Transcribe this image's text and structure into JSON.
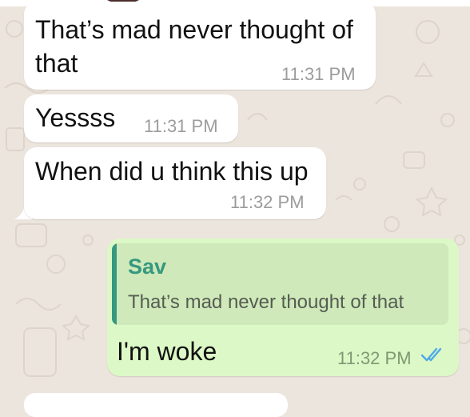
{
  "chat": {
    "messages": [
      {
        "direction": "incoming",
        "text": "That’s mad never thought of",
        "text_line2": "that",
        "time": "11:31 PM"
      },
      {
        "direction": "incoming",
        "text": "Yessss",
        "time": "11:31 PM"
      },
      {
        "direction": "incoming",
        "text": "When did u think this up",
        "time": "11:32 PM"
      },
      {
        "direction": "outgoing",
        "quoted": {
          "author": "Sav",
          "text": "That’s mad never thought of that"
        },
        "text": "I'm woke",
        "time": "11:32 PM",
        "status": "read"
      }
    ]
  },
  "colors": {
    "wallpaper": "#ece5dd",
    "incoming_bubble": "#ffffff",
    "outgoing_bubble": "#dcf8c6",
    "quote_accent": "#35987f",
    "read_ticks": "#4fa9e6"
  },
  "icons": {
    "read_receipt": "double-check-icon"
  }
}
